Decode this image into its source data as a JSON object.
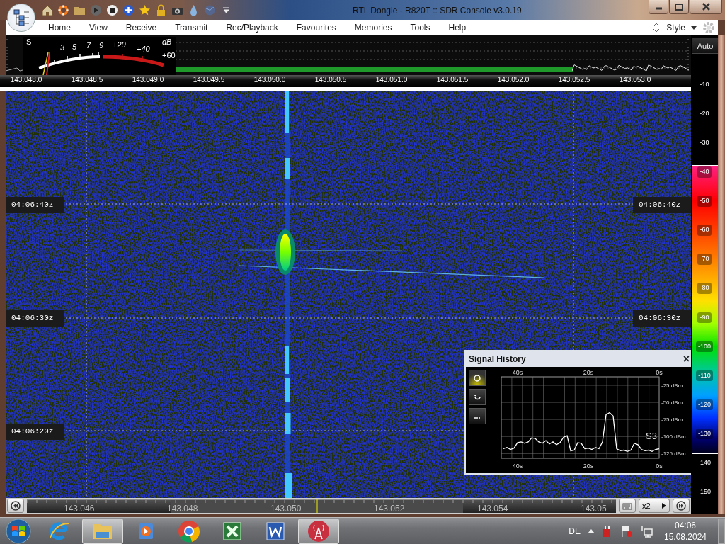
{
  "window": {
    "title": "RTL Dongle - R820T :: SDR Console v3.0.19"
  },
  "menu": [
    {
      "label": "Home"
    },
    {
      "label": "View"
    },
    {
      "label": "Receive"
    },
    {
      "label": "Transmit"
    },
    {
      "label": "Rec/Playback"
    },
    {
      "label": "Favourites"
    },
    {
      "label": "Memories"
    },
    {
      "label": "Tools"
    },
    {
      "label": "Help"
    }
  ],
  "style_menu": {
    "label": "Style"
  },
  "s_meter": {
    "labels": [
      "S",
      "3",
      "5",
      "7",
      "9",
      "+20",
      "+40",
      "dB",
      "+60"
    ]
  },
  "frequency_axis": [
    "143.048.0",
    "143.048.5",
    "143.049.0",
    "143.049.5",
    "143.050.0",
    "143.050.5",
    "143.051.0",
    "143.051.5",
    "143.052.0",
    "143.052.5",
    "143.053.0"
  ],
  "waterfall": {
    "time_labels_left": [
      "04:06:40z",
      "04:06:30z",
      "04:06:20z"
    ],
    "time_labels_right": [
      "04:06:40z",
      "04:06:30z"
    ]
  },
  "level_scale": {
    "auto_button": "Auto",
    "ticks": [
      "-10",
      "-20",
      "-30",
      "-40",
      "-50",
      "-60",
      "-70",
      "-80",
      "-90",
      "-100",
      "-110",
      "-120",
      "-130",
      "-140",
      "-150"
    ]
  },
  "signal_history": {
    "title": "Signal History",
    "close": "×",
    "time_ticks_top": [
      "40s",
      "20s",
      "0s"
    ],
    "reading": "S3",
    "chart_data": {
      "type": "line",
      "grid": true,
      "x": [
        44,
        43,
        42,
        41,
        40,
        39,
        38,
        37,
        36,
        35,
        34,
        33,
        32,
        31,
        30,
        29,
        28,
        27,
        26,
        25,
        24,
        23,
        22,
        21,
        20,
        19,
        18,
        17,
        16,
        15,
        14,
        13,
        12,
        11,
        10,
        9,
        8,
        7,
        6,
        5,
        4,
        3,
        2,
        1,
        0
      ],
      "series": [
        {
          "color": "#ffffff",
          "values": [
            -118,
            -116,
            -119,
            -117,
            -109,
            -108,
            -110,
            -108,
            -102,
            -103,
            -108,
            -110,
            -106,
            -111,
            -108,
            -112,
            -109,
            -101,
            -99,
            -121,
            -120,
            -109,
            -110,
            -118,
            -117,
            -119,
            -116,
            -118,
            -108,
            -68,
            -65,
            -70,
            -118,
            -121,
            -120,
            -122,
            -120,
            -110,
            -112,
            -119,
            -121,
            -120,
            -122,
            -119,
            -118
          ]
        }
      ],
      "xlim": [
        44.6,
        0
      ],
      "ylim": [
        -132,
        -12.5
      ],
      "xticks": [
        {
          "value": 40,
          "label": "40s"
        },
        {
          "value": 20,
          "label": "20s"
        },
        {
          "value": 0,
          "label": "0s"
        }
      ],
      "yticks": [
        {
          "value": -25,
          "label": "-25 dBm"
        },
        {
          "value": -50,
          "label": "-50 dBm"
        },
        {
          "value": -75,
          "label": "-75 dBm"
        },
        {
          "value": -100,
          "label": "-100 dBm"
        },
        {
          "value": -125,
          "label": "-125 dBm"
        }
      ]
    }
  },
  "bottom_bar": {
    "ticks": [
      "143.046",
      "143.048",
      "143.050",
      "143.052",
      "143.054",
      "143.05"
    ],
    "zoom": "x2"
  },
  "taskbar": {
    "apps": [
      {
        "kind": "ie",
        "selected": false
      },
      {
        "kind": "explorer",
        "selected": true
      },
      {
        "kind": "media",
        "selected": false
      },
      {
        "kind": "chrome",
        "selected": false
      },
      {
        "kind": "excel",
        "selected": false
      },
      {
        "kind": "word",
        "selected": false
      },
      {
        "kind": "sdr",
        "selected": true
      }
    ],
    "language": "DE",
    "time": "04:06",
    "date": "15.08.2024"
  }
}
